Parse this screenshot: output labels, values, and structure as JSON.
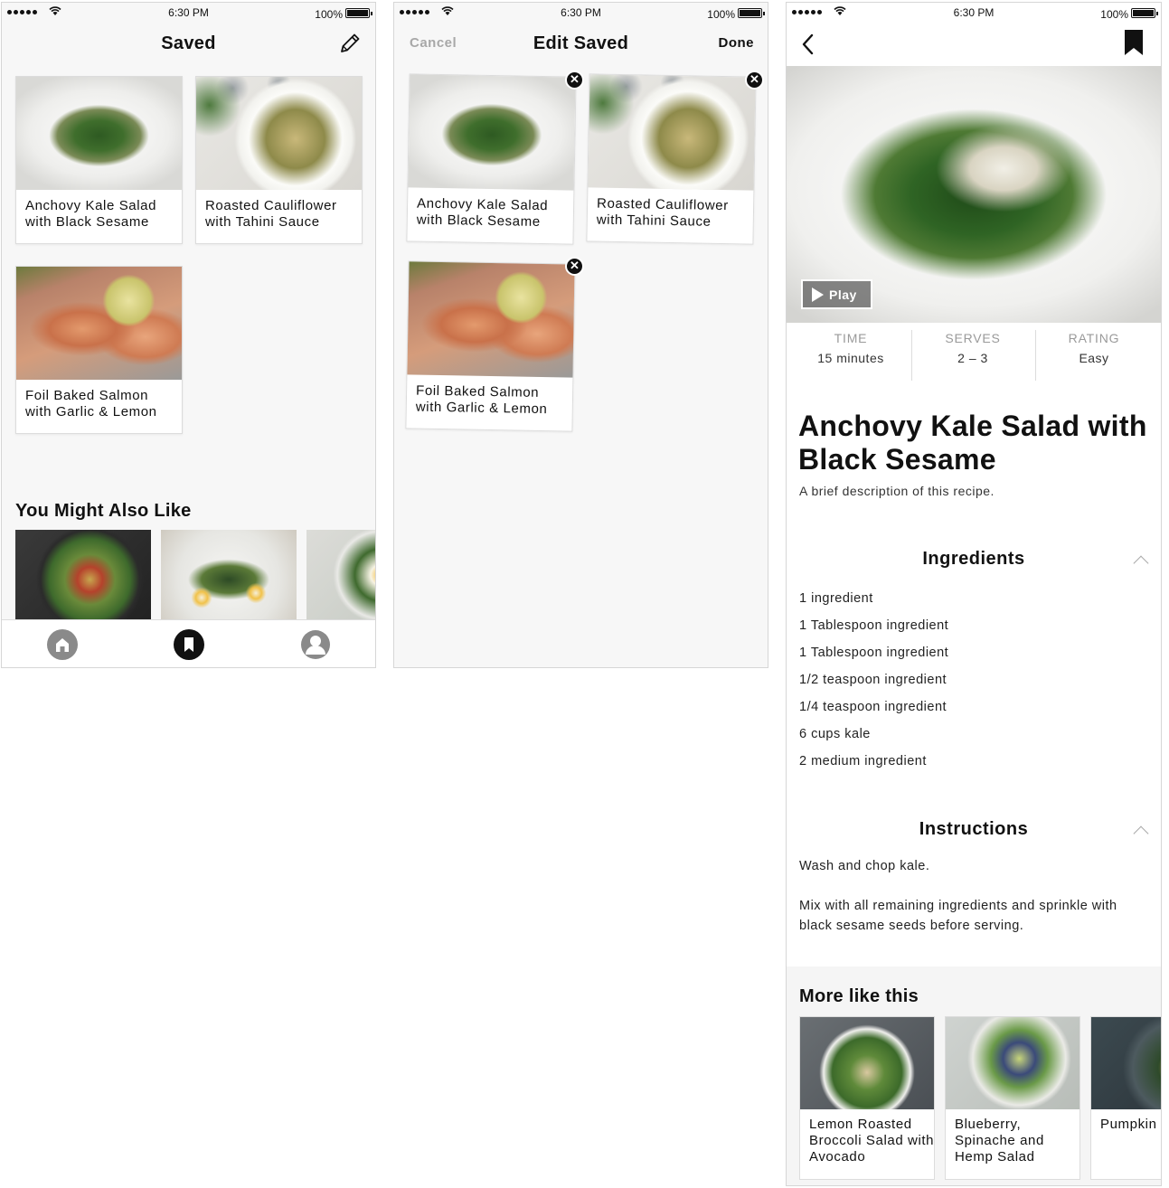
{
  "status": {
    "time": "6:30 PM",
    "battery_pct": "100%"
  },
  "saved_screen": {
    "title": "Saved",
    "recipes": [
      {
        "title": "Anchovy Kale Salad with Black Sesame"
      },
      {
        "title": "Roasted Cauliflower with Tahini Sauce"
      },
      {
        "title": "Foil Baked Salmon with Garlic & Lemon"
      }
    ],
    "suggestions_title": "You Might Also Like",
    "tabs": [
      "home",
      "saved",
      "profile"
    ]
  },
  "edit_screen": {
    "cancel_label": "Cancel",
    "title": "Edit Saved",
    "done_label": "Done",
    "recipes": [
      {
        "title": "Anchovy Kale Salad with Black Sesame"
      },
      {
        "title": "Roasted Cauliflower with Tahini Sauce"
      },
      {
        "title": "Foil Baked Salmon with Garlic & Lemon"
      }
    ]
  },
  "detail_screen": {
    "play_label": "Play",
    "meta": [
      {
        "label": "TIME",
        "value": "15 minutes"
      },
      {
        "label": "SERVES",
        "value": "2 – 3"
      },
      {
        "label": "RATING",
        "value": "Easy"
      }
    ],
    "title": "Anchovy Kale Salad with Black Sesame",
    "description": "A brief description of this recipe.",
    "ingredients_title": "Ingredients",
    "ingredients": [
      "1 ingredient",
      "1 Tablespoon ingredient",
      "1 Tablespoon ingredient",
      "1/2 teaspoon ingredient",
      "1/4 teaspoon ingredient",
      "6 cups kale",
      "2 medium ingredient"
    ],
    "instructions_title": "Instructions",
    "instructions": [
      "Wash and chop kale.",
      "Mix with all remaining ingredients and sprinkle with black sesame seeds before serving."
    ],
    "more_title": "More like this",
    "more": [
      {
        "title": "Lemon Roasted Broccoli Salad with Avocado"
      },
      {
        "title": "Blueberry, Spinache and Hemp Salad"
      },
      {
        "title": "Pumpkin Cupcake"
      }
    ]
  },
  "colors": {
    "accent": "#111111",
    "muted": "#a8a8a8",
    "background": "#f7f7f7"
  }
}
